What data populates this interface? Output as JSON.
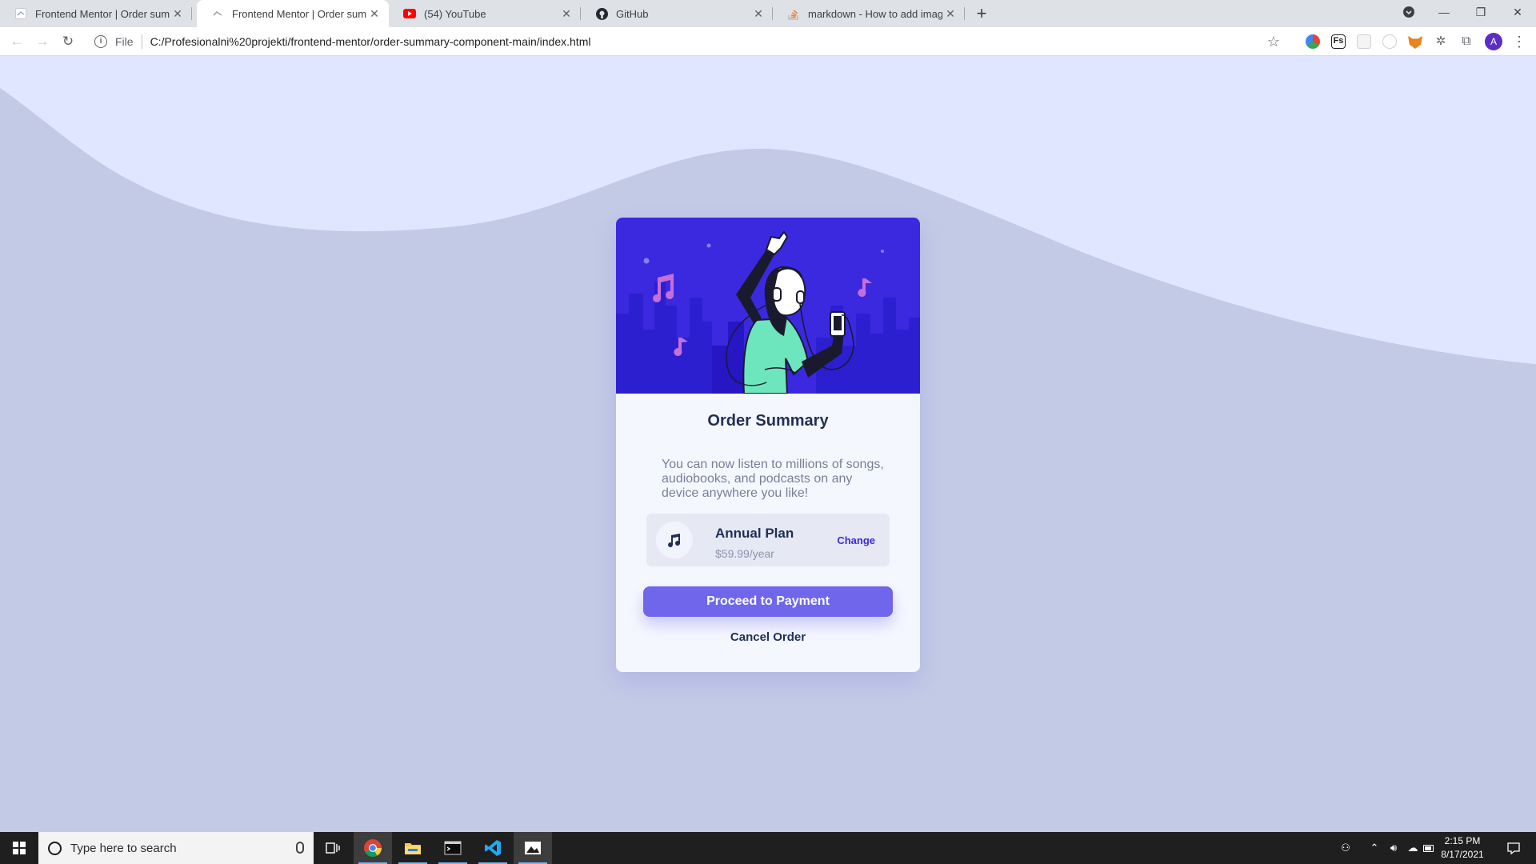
{
  "browser": {
    "tabs": [
      {
        "title": "Frontend Mentor | Order summa",
        "icon": "frontend-mentor-icon",
        "active": false
      },
      {
        "title": "Frontend Mentor | Order summa",
        "icon": "frontend-mentor-icon",
        "active": true
      },
      {
        "title": "(54) YouTube",
        "icon": "youtube-icon",
        "active": false
      },
      {
        "title": "GitHub",
        "icon": "github-icon",
        "active": false
      },
      {
        "title": "markdown - How to add images",
        "icon": "stackoverflow-icon",
        "active": false
      }
    ],
    "address": {
      "scheme_label": "File",
      "url": "C:/Profesionalni%20projekti/frontend-mentor/order-summary-component-main/index.html"
    },
    "profile_initial": "A"
  },
  "card": {
    "title": "Order Summary",
    "description": "You can now listen to millions of songs, audiobooks, and podcasts on any device anywhere you like!",
    "plan": {
      "name": "Annual Plan",
      "price": "$59.99/year",
      "change_label": "Change",
      "icon": "music-note-icon"
    },
    "proceed_label": "Proceed to Payment",
    "cancel_label": "Cancel Order"
  },
  "taskbar": {
    "search_placeholder": "Type here to search",
    "time": "2:15 PM",
    "date": "8/17/2021"
  },
  "colors": {
    "page_background": "#c3cae6",
    "wave": "#e0e6ff",
    "card_background": "#f5f7ff",
    "primary_button": "#6f66ec",
    "title": "#1f2f56",
    "bright_blue": "#382ae0"
  }
}
